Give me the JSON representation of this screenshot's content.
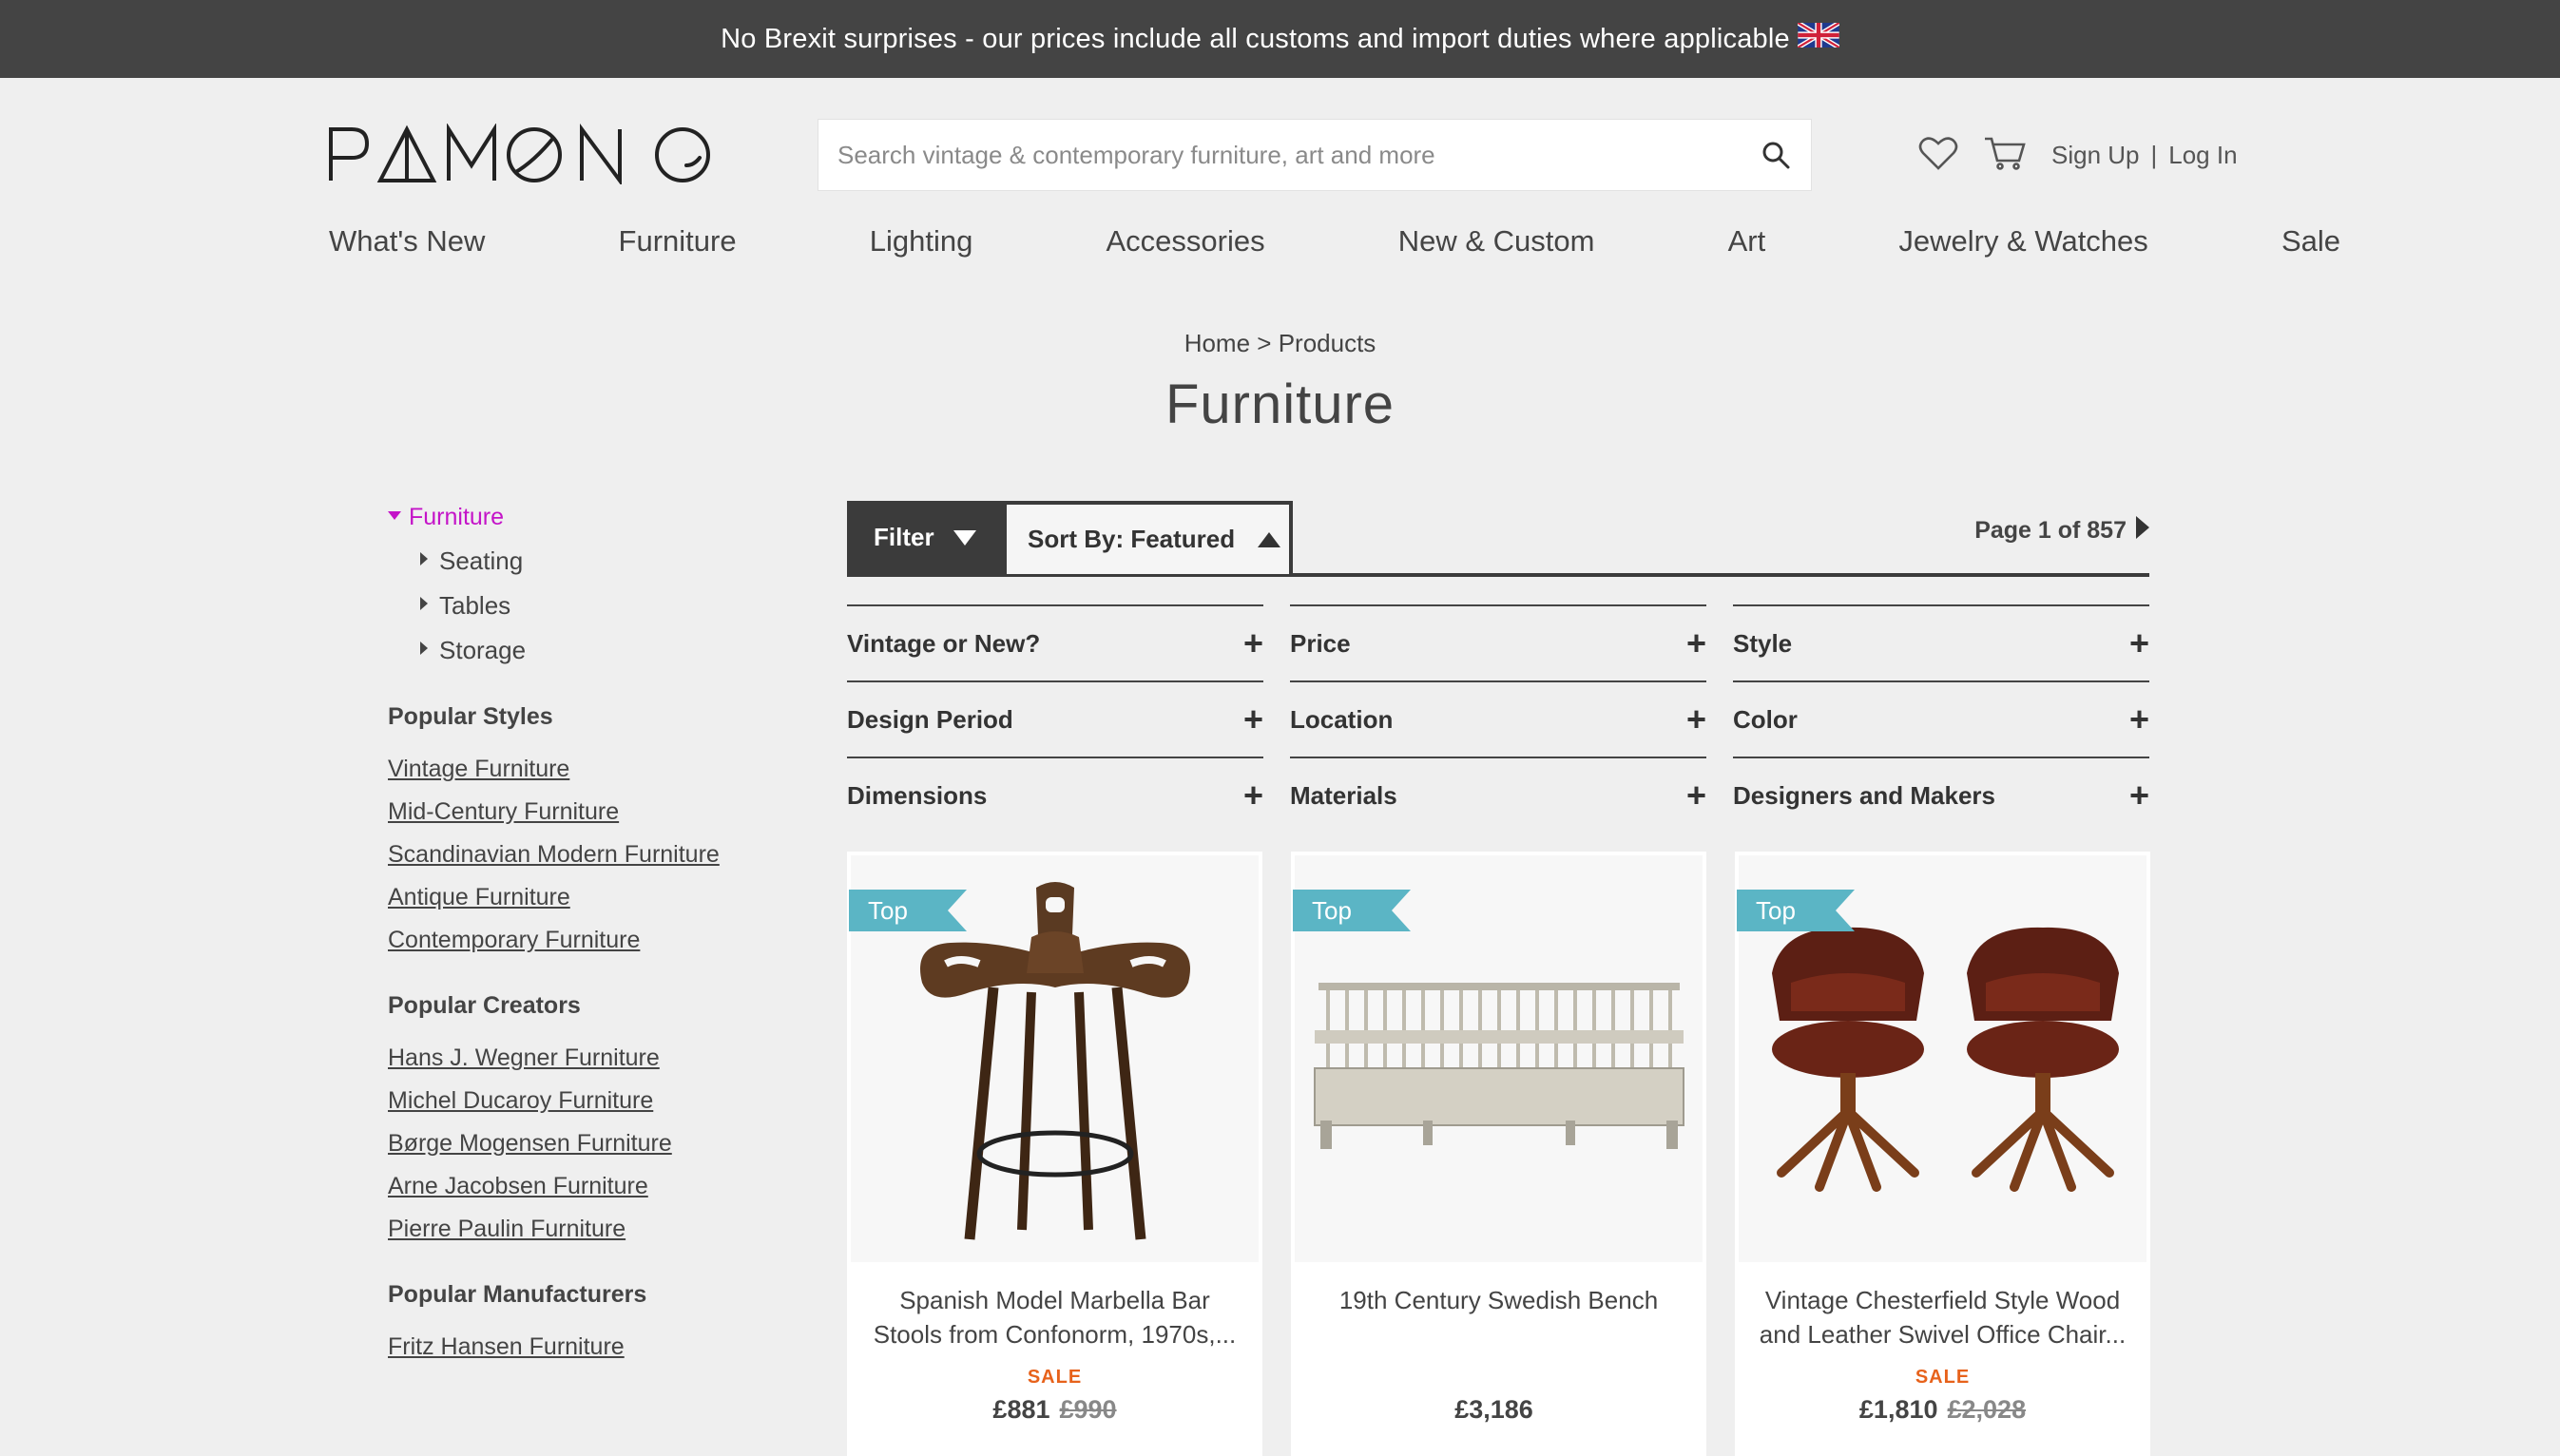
{
  "banner": {
    "text": "No Brexit surprises - our prices include all customs and import duties where applicable"
  },
  "logo": {
    "text": "PAMONO"
  },
  "search": {
    "placeholder": "Search vintage & contemporary furniture, art and more"
  },
  "header": {
    "sign_up": "Sign Up",
    "separator": "|",
    "log_in": "Log In"
  },
  "nav": {
    "items": [
      "What's New",
      "Furniture",
      "Lighting",
      "Accessories",
      "New & Custom",
      "Art",
      "Jewelry & Watches",
      "Sale"
    ]
  },
  "breadcrumb": {
    "home": "Home",
    "sep": ">",
    "current": "Products"
  },
  "page_title": "Furniture",
  "sidebar": {
    "category": "Furniture",
    "subcategories": [
      "Seating",
      "Tables",
      "Storage"
    ],
    "styles_heading": "Popular Styles",
    "styles": [
      "Vintage Furniture",
      "Mid-Century Furniture",
      "Scandinavian Modern Furniture",
      "Antique Furniture",
      "Contemporary Furniture"
    ],
    "creators_heading": "Popular Creators",
    "creators": [
      "Hans J. Wegner Furniture",
      "Michel Ducaroy Furniture",
      "Børge Mogensen Furniture",
      "Arne Jacobsen Furniture",
      "Pierre Paulin Furniture"
    ],
    "manufacturers_heading": "Popular Manufacturers",
    "manufacturers": [
      "Fritz Hansen Furniture"
    ]
  },
  "toolbar": {
    "filter_label": "Filter",
    "sort_label": "Sort By: Featured",
    "pager": "Page 1 of 857"
  },
  "facets": [
    "Vintage or New?",
    "Price",
    "Style",
    "Design Period",
    "Location",
    "Color",
    "Dimensions",
    "Materials",
    "Designers and Makers"
  ],
  "products": [
    {
      "tag": "Top",
      "title": "Spanish Model Marbella Bar Stools from Confonorm, 1970s,...",
      "sale": "SALE",
      "price": "£881",
      "old_price": "£990"
    },
    {
      "tag": "Top",
      "title": "19th Century Swedish Bench",
      "sale": "",
      "price": "£3,186",
      "old_price": ""
    },
    {
      "tag": "Top",
      "title": "Vintage Chesterfield Style Wood and Leather Swivel Office Chair...",
      "sale": "SALE",
      "price": "£1,810",
      "old_price": "£2,028"
    }
  ],
  "colors": {
    "banner_bg": "#444444",
    "accent_magenta": "#c414c8",
    "tag_teal": "#5bb5c5",
    "sale_orange": "#e7621b"
  }
}
